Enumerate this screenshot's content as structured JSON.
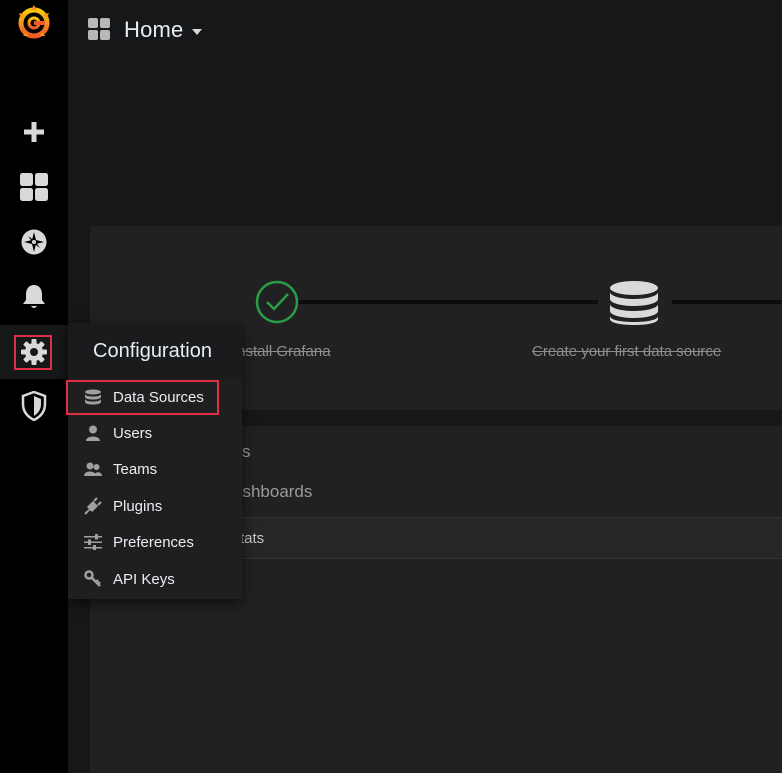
{
  "header": {
    "title": "Home"
  },
  "sidebar": {
    "items": [
      {
        "icon": "grafana-logo"
      },
      {
        "icon": "plus-icon"
      },
      {
        "icon": "dashboards-icon"
      },
      {
        "icon": "explore-compass-icon"
      },
      {
        "icon": "alerting-bell-icon"
      },
      {
        "icon": "configuration-gear-icon"
      },
      {
        "icon": "server-admin-shield-icon"
      }
    ]
  },
  "steps": {
    "install": "Install Grafana",
    "datasource": "Create your first data source"
  },
  "lower": {
    "line1": "s",
    "line2": "ashboards",
    "stats": "tats"
  },
  "config_menu": {
    "title": "Configuration",
    "items": [
      {
        "label": "Data Sources",
        "icon": "database-icon"
      },
      {
        "label": "Users",
        "icon": "user-icon"
      },
      {
        "label": "Teams",
        "icon": "teams-icon"
      },
      {
        "label": "Plugins",
        "icon": "plug-icon"
      },
      {
        "label": "Preferences",
        "icon": "sliders-icon"
      },
      {
        "label": "API Keys",
        "icon": "key-icon"
      }
    ]
  },
  "colors": {
    "accent_orange": "#f46800",
    "check_green": "#299c46",
    "highlight_red": "#e02f44"
  }
}
